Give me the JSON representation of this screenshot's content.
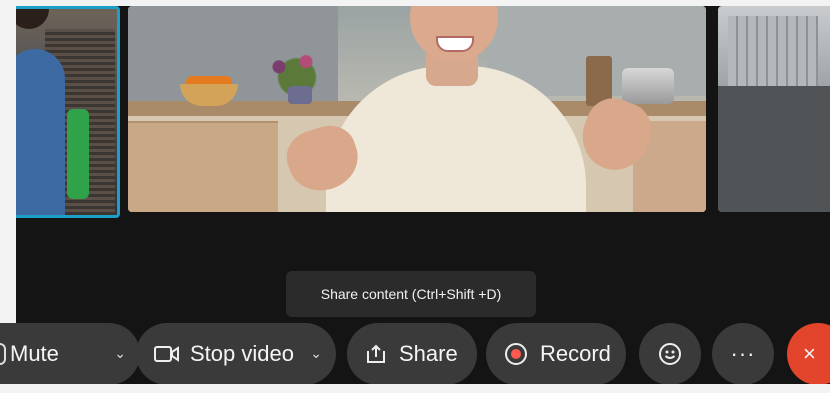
{
  "tooltip": {
    "text": "Share content (Ctrl+Shift +D)"
  },
  "controls": {
    "mute": {
      "label": "Mute",
      "icon": "microphone-icon"
    },
    "video": {
      "label": "Stop video",
      "icon": "camera-icon"
    },
    "share": {
      "label": "Share",
      "icon": "share-icon"
    },
    "record": {
      "label": "Record",
      "icon": "record-icon"
    },
    "reactions": {
      "icon": "smiley-icon"
    },
    "more": {
      "icon": "more-icon",
      "glyph": "···"
    },
    "leave": {
      "icon": "leave-icon",
      "glyph": "×"
    }
  },
  "colors": {
    "active_speaker_border": "#1da0c8",
    "leave_button": "#e2452c",
    "record_dot": "#ff5a4e"
  }
}
